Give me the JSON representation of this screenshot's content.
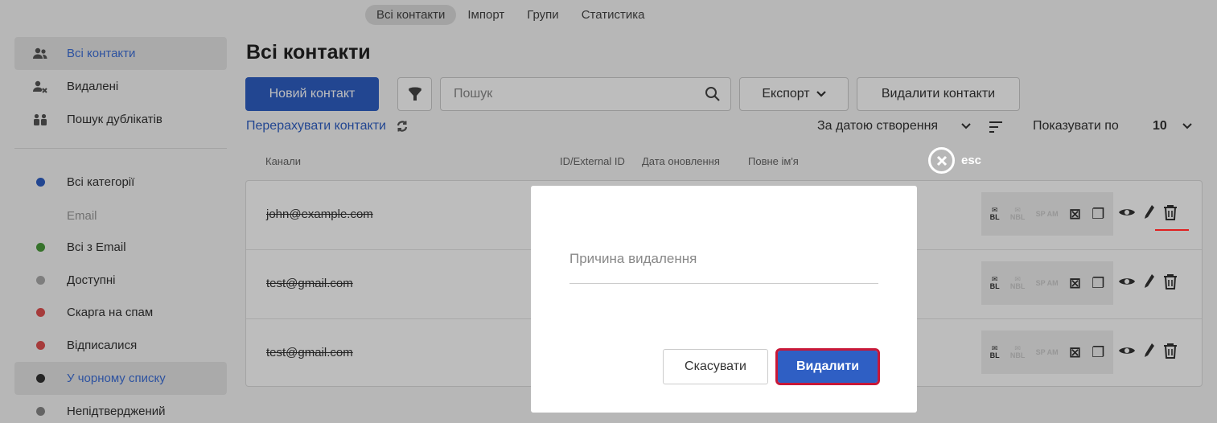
{
  "topnav": {
    "tabs": [
      {
        "label": "Всі контакти",
        "active": true
      },
      {
        "label": "Імпорт"
      },
      {
        "label": "Групи"
      },
      {
        "label": "Статистика"
      }
    ]
  },
  "sidebar": {
    "items": [
      {
        "label": "Всі контакти",
        "icon": "users-icon",
        "active": true
      },
      {
        "label": "Видалені",
        "icon": "user-removed-icon"
      },
      {
        "label": "Пошук дублікатів",
        "icon": "duplicates-icon"
      }
    ],
    "categories": [
      {
        "label": "Всі категорії",
        "color": "#2f5fc4"
      },
      {
        "label": "Всі з Email",
        "color": "#4a9a3a"
      },
      {
        "label": "Доступні",
        "color": "#aaaaaa"
      },
      {
        "label": "Скарга на спам",
        "color": "#e05050"
      },
      {
        "label": "Відписалися",
        "color": "#e05050"
      },
      {
        "label": "У чорному списку",
        "color": "#333333",
        "active": true
      },
      {
        "label": "Непідтверджений",
        "color": "#888888"
      }
    ],
    "email_section_title": "Email"
  },
  "main": {
    "title": "Всі контакти",
    "new_contact_label": "Новий контакт",
    "search_placeholder": "Пошук",
    "export_label": "Експорт",
    "delete_contacts_label": "Видалити контакти",
    "recount_label": "Перерахувати контакти",
    "sort_label": "За датою створення",
    "per_page_label": "Показувати по",
    "per_page_value": "10",
    "columns": [
      "Канали",
      "ID/External ID",
      "Дата оновлення",
      "Повне ім'я"
    ],
    "rows": [
      {
        "email": "john@example.com"
      },
      {
        "email": "test@gmail.com"
      },
      {
        "email": "test@gmail.com"
      }
    ],
    "channel_badges": {
      "bl": "BL",
      "nbl": "NBL",
      "spam": "SP AM"
    }
  },
  "modal": {
    "esc_label": "esc",
    "reason_placeholder": "Причина видалення",
    "cancel_label": "Скасувати",
    "delete_label": "Видалити"
  },
  "colors": {
    "accent": "#2f5fc4",
    "danger": "#c81838"
  }
}
